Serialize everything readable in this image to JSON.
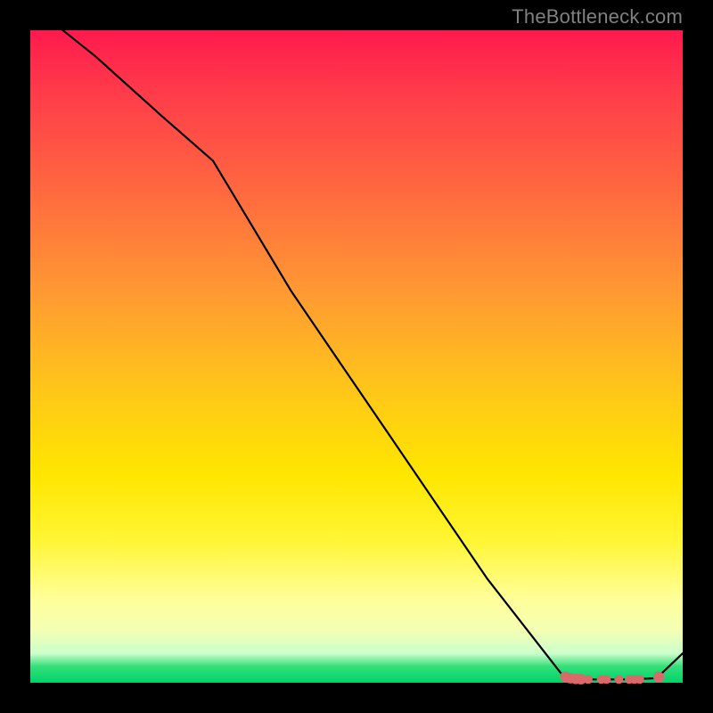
{
  "attribution": "TheBottleneck.com",
  "colors": {
    "background": "#000000",
    "line": "#000000",
    "marker_fill": "#d86a6a",
    "marker_stroke": "#c65858",
    "gradient_top": "#ff1a4d",
    "gradient_bottom": "#00d26a"
  },
  "chart_data": {
    "type": "line",
    "title": "",
    "xlabel": "",
    "ylabel": "",
    "xlim": [
      0,
      100
    ],
    "ylim": [
      0,
      100
    ],
    "series": [
      {
        "name": "curve",
        "x": [
          0,
          10,
          20,
          28,
          40,
          55,
          70,
          82,
          84,
          88,
          92,
          96,
          100
        ],
        "y": [
          104,
          96,
          87,
          80,
          60,
          38,
          16,
          0.6,
          0.5,
          0.5,
          0.5,
          0.7,
          4.5
        ]
      }
    ],
    "markers": {
      "name": "highlight-segment",
      "points": [
        {
          "x": 82.0,
          "y": 0.9,
          "r": 6
        },
        {
          "x": 82.8,
          "y": 0.7,
          "r": 6
        },
        {
          "x": 83.6,
          "y": 0.6,
          "r": 6
        },
        {
          "x": 84.4,
          "y": 0.55,
          "r": 6
        },
        {
          "x": 85.5,
          "y": 0.5,
          "r": 5
        },
        {
          "x": 87.5,
          "y": 0.5,
          "r": 5
        },
        {
          "x": 88.3,
          "y": 0.5,
          "r": 5
        },
        {
          "x": 90.2,
          "y": 0.5,
          "r": 5
        },
        {
          "x": 91.8,
          "y": 0.5,
          "r": 5
        },
        {
          "x": 92.6,
          "y": 0.5,
          "r": 5
        },
        {
          "x": 93.4,
          "y": 0.5,
          "r": 5
        },
        {
          "x": 96.3,
          "y": 0.9,
          "r": 6
        }
      ]
    }
  }
}
